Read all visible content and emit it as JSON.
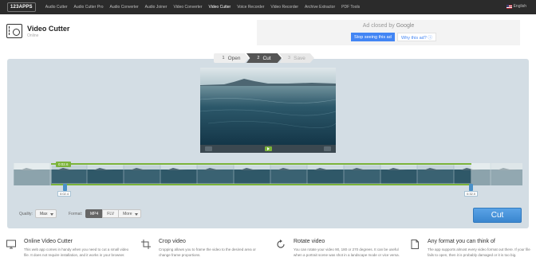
{
  "topbar": {
    "logo": "123APPS",
    "nav": [
      "Audio Cutter",
      "Audio Cutter Pro",
      "Audio Converter",
      "Audio Joiner",
      "Video Converter",
      "Video Cutter",
      "Voice Recorder",
      "Video Recorder",
      "Archive Extractor",
      "PDF Tools"
    ],
    "active_nav": "Video Cutter",
    "language": "English"
  },
  "app": {
    "title": "Video Cutter",
    "subtitle": "Online"
  },
  "ad": {
    "closed_prefix": "Ad closed by",
    "closed_brand": "Google",
    "stop_label": "Stop seeing this ad",
    "why_label": "Why this ad? ⓘ"
  },
  "steps": [
    {
      "num": "1",
      "label": "Open"
    },
    {
      "num": "2",
      "label": "Cut"
    },
    {
      "num": "3",
      "label": "Save"
    }
  ],
  "active_step": 1,
  "timeline": {
    "selection_duration": "0:02.6",
    "start_time": "0:02.4",
    "end_time": "0:32.0"
  },
  "controls": {
    "quality_label": "Quality:",
    "quality_value": "Max",
    "format_label": "Format:",
    "formats": [
      "MP4",
      "FLV",
      "More"
    ],
    "active_format": "MP4",
    "cut_label": "Cut"
  },
  "features": [
    {
      "icon": "globe-screen-icon",
      "title": "Online Video Cutter",
      "desc": "This web app comes in handy when you need to cut a small video file. It does not require installation, and it works in your browser."
    },
    {
      "icon": "crop-icon",
      "title": "Crop video",
      "desc": "Cropping allows you to frame the video to the desired area or change frame proportions."
    },
    {
      "icon": "rotate-icon",
      "title": "Rotate video",
      "desc": "You can rotate your video 90, 180 or 270 degrees. It can be useful when a portrait scene was shot in a landscape mode or vice versa."
    },
    {
      "icon": "file-format-icon",
      "title": "Any format you can think of",
      "desc": "The app supports almost every video format out there. If your file fails to open, then it is probably damaged or it is too big."
    }
  ],
  "colors": {
    "topbar": "#2b2b2b",
    "panel": "#d3dde4",
    "accent_green": "#7bb33a",
    "accent_blue": "#3a86cf"
  }
}
